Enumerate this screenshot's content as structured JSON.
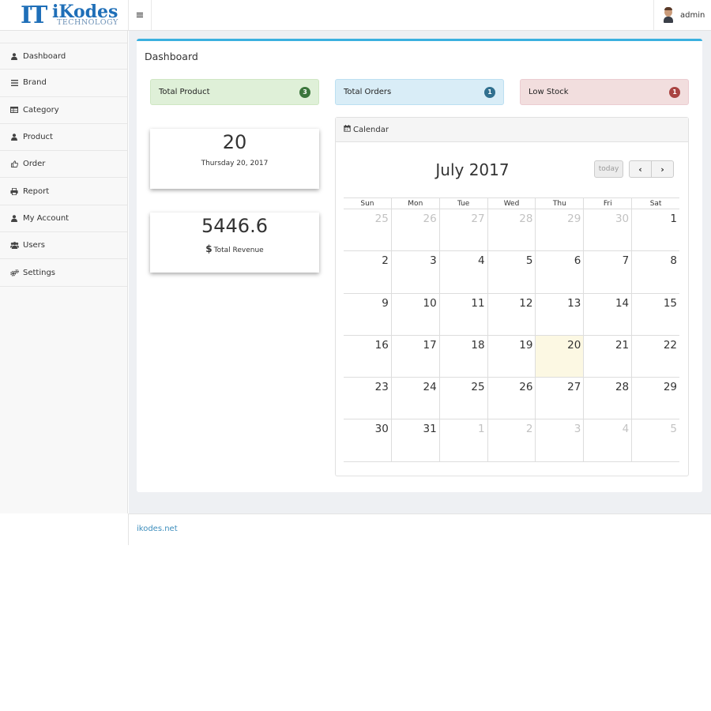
{
  "brand": {
    "logo_mark": "IT",
    "name": "iKodes",
    "tagline": "TECHNOLOGY"
  },
  "header": {
    "user_name": "admin"
  },
  "sidebar": {
    "items": [
      {
        "label": "Dashboard",
        "icon": "user-icon"
      },
      {
        "label": "Brand",
        "icon": "list-icon"
      },
      {
        "label": "Category",
        "icon": "table-icon"
      },
      {
        "label": "Product",
        "icon": "user-icon"
      },
      {
        "label": "Order",
        "icon": "thumbs-up-icon"
      },
      {
        "label": "Report",
        "icon": "print-icon"
      },
      {
        "label": "My Account",
        "icon": "user-icon"
      },
      {
        "label": "Users",
        "icon": "users-icon"
      },
      {
        "label": "Settings",
        "icon": "gears-icon"
      }
    ]
  },
  "main": {
    "title": "Dashboard",
    "stats": [
      {
        "label": "Total Product",
        "count": "3",
        "color": "#3c763d"
      },
      {
        "label": "Total Orders",
        "count": "1",
        "color": "#31708f"
      },
      {
        "label": "Low Stock",
        "count": "1",
        "color": "#a94442"
      }
    ],
    "date_card": {
      "value": "20",
      "caption": "Thursday 20, 2017"
    },
    "revenue_card": {
      "value": "5446.6",
      "currency_symbol": "$",
      "caption": "Total Revenue"
    },
    "calendar": {
      "header": "Calendar",
      "month_title": "July 2017",
      "today_label": "today",
      "weekdays": [
        "Sun",
        "Mon",
        "Tue",
        "Wed",
        "Thu",
        "Fri",
        "Sat"
      ],
      "weeks": [
        [
          "25",
          "26",
          "27",
          "28",
          "29",
          "30",
          "1"
        ],
        [
          "2",
          "3",
          "4",
          "5",
          "6",
          "7",
          "8"
        ],
        [
          "9",
          "10",
          "11",
          "12",
          "13",
          "14",
          "15"
        ],
        [
          "16",
          "17",
          "18",
          "19",
          "20",
          "21",
          "22"
        ],
        [
          "23",
          "24",
          "25",
          "26",
          "27",
          "28",
          "29"
        ],
        [
          "30",
          "31",
          "1",
          "2",
          "3",
          "4",
          "5"
        ]
      ],
      "today_color": "#fcf8e3"
    }
  },
  "footer": {
    "link": "ikodes.net"
  },
  "colors": {
    "accent": "#3bb0df",
    "link": "#3c8dbc"
  }
}
